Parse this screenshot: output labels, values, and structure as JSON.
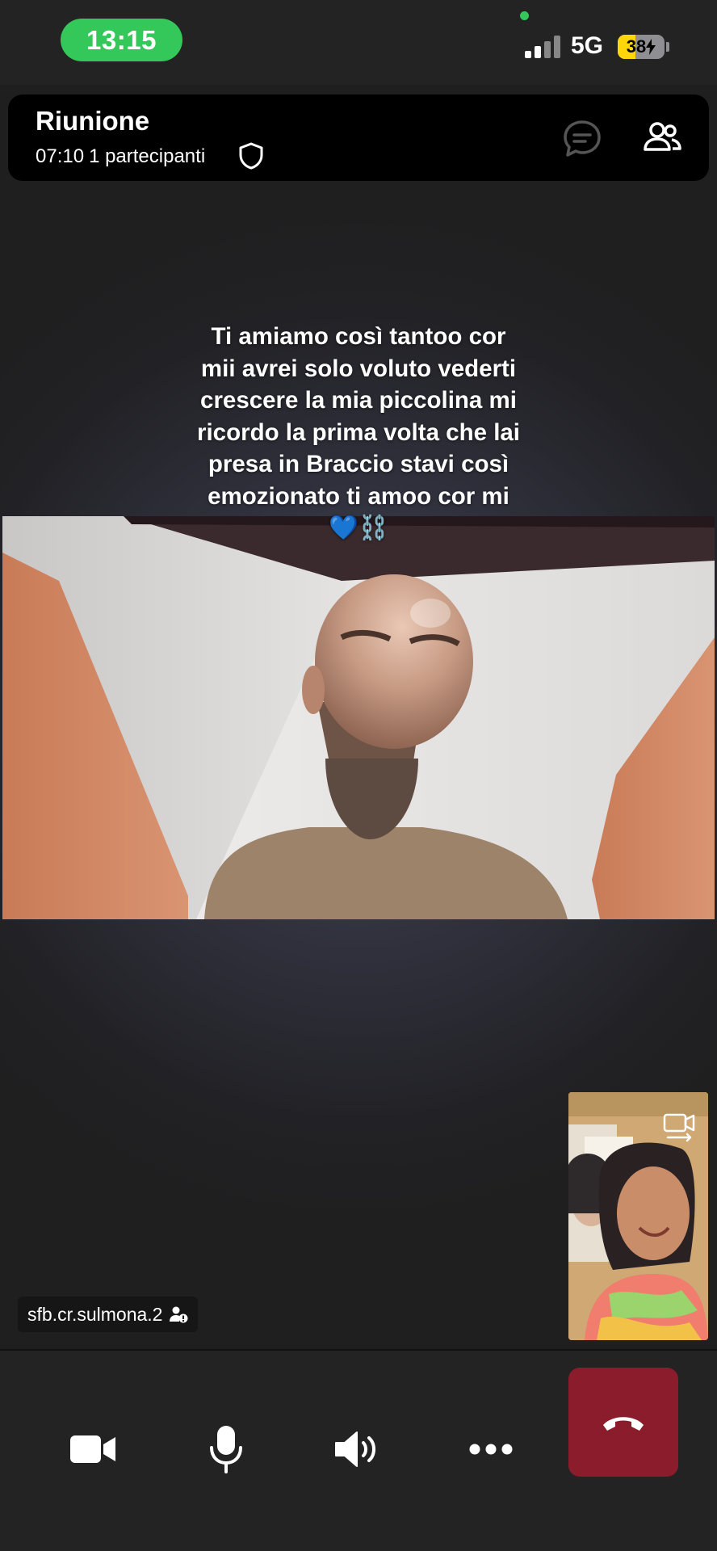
{
  "status_bar": {
    "time": "13:15",
    "network": "5G",
    "battery_percent": "38",
    "battery_level": 0.38,
    "charging": true,
    "colors": {
      "time_pill": "#34c759",
      "battery": "#ffd60a"
    },
    "icons": [
      "signal-icon",
      "charging-bolt-icon"
    ]
  },
  "header": {
    "title": "Riunione",
    "elapsed": "07:10",
    "participants": "1 partecipanti",
    "icons": [
      "shield-icon",
      "chat-icon",
      "participants-icon"
    ]
  },
  "caption": {
    "text": "Ti amiamo così tantoo cor mii avrei solo voluto vederti crescere la mia piccolina mi ricordo la prima volta che lai presa in Braccio stavi così emozionato ti amoo cor mi 💙⛓️"
  },
  "name_tag": {
    "label": "sfb.cr.sulmona.2",
    "icon": "anonymous-info-icon"
  },
  "self_view": {
    "icon": "switch-camera-icon"
  },
  "controls": {
    "icons": [
      "video-camera-icon",
      "microphone-icon",
      "speaker-icon",
      "more-icon",
      "hang-up-icon"
    ],
    "end_call_color": "#8a1c2b"
  }
}
